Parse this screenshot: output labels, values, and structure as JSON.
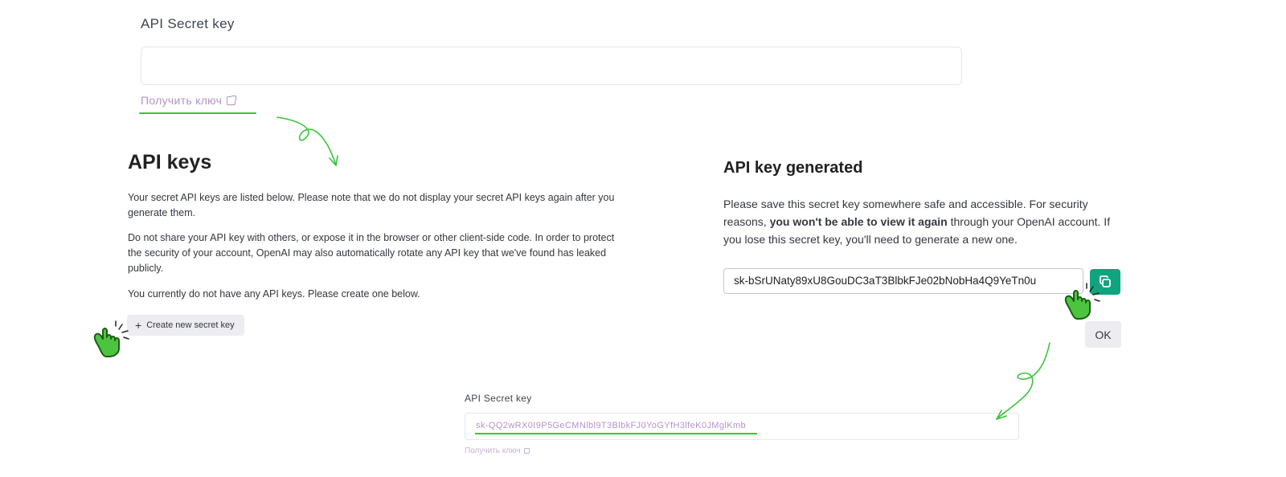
{
  "top_field": {
    "label": "API Secret key",
    "value": "",
    "get_key_link": "Получить ключ"
  },
  "keys_panel": {
    "title": "API keys",
    "paragraph1": "Your secret API keys are listed below. Please note that we do not display your secret API keys again after you generate them.",
    "paragraph2": "Do not share your API key with others, or expose it in the browser or other client-side code. In order to protect the security of your account, OpenAI may also automatically rotate any API key that we've found has leaked publicly.",
    "paragraph3": "You currently do not have any API keys. Please create one below.",
    "create_button": "Create new secret key"
  },
  "generated_panel": {
    "title": "API key generated",
    "text_before": "Please save this secret key somewhere safe and accessible. For security reasons, ",
    "text_bold": "you won't be able to view it again",
    "text_after": " through your OpenAI account. If you lose this secret key, you'll need to generate a new one.",
    "key_value": "sk-bSrUNaty89xU8GouDC3aT3BlbkFJe02bNobHa4Q9YeTn0u",
    "ok_button": "OK"
  },
  "bottom_field": {
    "label": "API Secret key",
    "value": "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",
    "get_key_link": "Получить ключ"
  },
  "colors": {
    "accent_green": "#10a37f",
    "annotation_green": "#3ac43a",
    "link_purple": "#b493c9"
  }
}
